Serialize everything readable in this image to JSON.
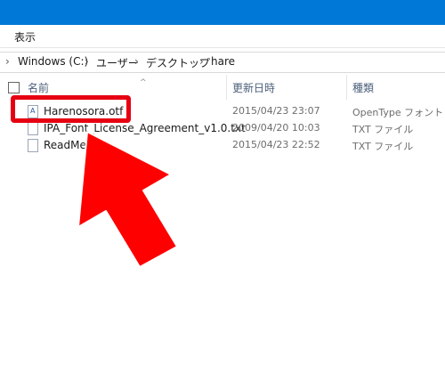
{
  "ribbon": {
    "view_tab": "表示"
  },
  "breadcrumb": {
    "items": [
      "Windows (C:)",
      "ユーザー",
      "デスクトップ",
      "hare"
    ],
    "separator": "›"
  },
  "columns": {
    "name": "名前",
    "date_modified": "更新日時",
    "type": "種類"
  },
  "files": [
    {
      "name": "Harenosora.otf",
      "date": "2015/04/23 23:07",
      "type": "OpenType フォント ..."
    },
    {
      "name": "IPA_Font_License_Agreement_v1.0.txt",
      "date": "2009/04/20 10:03",
      "type": "TXT ファイル"
    },
    {
      "name": "ReadMe.txt",
      "date": "2015/04/23 22:52",
      "type": "TXT ファイル"
    }
  ],
  "colors": {
    "titlebar": "#0078d7",
    "highlight": "#e60012"
  },
  "annotation_icon": "red-arrow-icon"
}
